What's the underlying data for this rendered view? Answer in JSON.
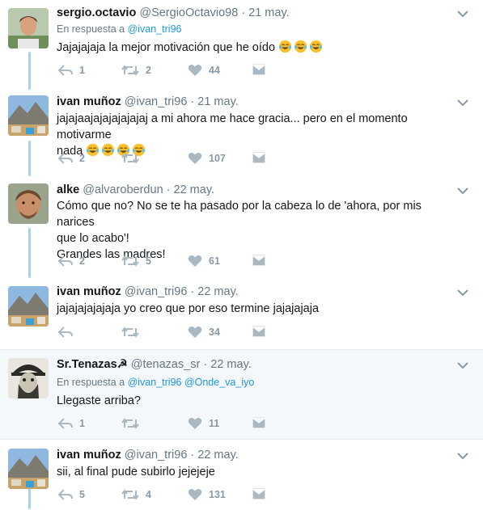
{
  "tweets": [
    {
      "name": "sergio.octavio",
      "handle": "@SergioOctavio98",
      "time": "· 21 may.",
      "reply_prefix": "En respuesta a",
      "reply_to": "@ivan_tri96",
      "text": "Jajajajaja la mejor motivación que he oído",
      "emoji": "laughing-tears-emoji",
      "emoji_count": 3,
      "replies": "1",
      "retweets": "2",
      "likes": "44"
    },
    {
      "name": "ivan muñoz",
      "handle": "@ivan_tri96",
      "time": "· 21 may.",
      "text_line1": "jajajaajajajajajajaj a mi ahora me hace gracia... pero en el momento motivarme",
      "text_line2": "nada",
      "emoji": "laughing-tears-emoji",
      "emoji_count": 4,
      "replies": "2",
      "retweets": "",
      "likes": "107"
    },
    {
      "name": "alke",
      "handle": "@alvaroberdun",
      "time": "· 22 may.",
      "text_line1": "Cómo que no? No se te ha pasado por la cabeza lo de 'ahora, por mis narices",
      "text_line2": "que lo acabo'!",
      "text_line3": "Grandes las madres!",
      "replies": "2",
      "retweets": "5",
      "likes": "61"
    },
    {
      "name": "ivan muñoz",
      "handle": "@ivan_tri96",
      "time": "· 22 may.",
      "text": "jajajajajajaja yo creo que por eso termine jajajajaja",
      "replies": "",
      "retweets": "",
      "likes": "34"
    },
    {
      "name": "Sr.Tenazas☭",
      "handle": "@tenazas_sr",
      "time": "· 22 may.",
      "reply_prefix": "En respuesta a",
      "reply_to": "@ivan_tri96 @Onde_va_iyo",
      "text": "Llegaste arriba?",
      "replies": "1",
      "retweets": "",
      "likes": "11"
    },
    {
      "name": "ivan muñoz",
      "handle": "@ivan_tri96",
      "time": "· 22 may.",
      "text": "sii, al final pude subirlo jejejeje",
      "replies": "5",
      "retweets": "4",
      "likes": "131"
    }
  ],
  "colors": {
    "thread_line": "#a4d3f2",
    "link": "#1b95e0",
    "muted": "#657786",
    "action": "#aab8c2",
    "highlight_bg": "#f5f8fa"
  }
}
